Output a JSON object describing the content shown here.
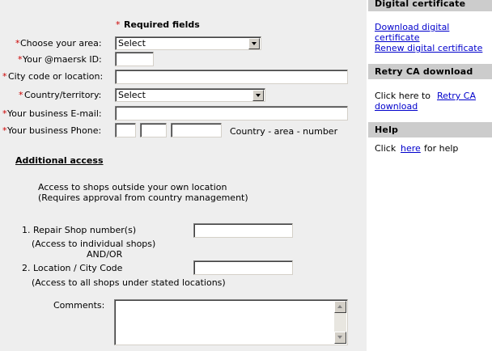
{
  "colors": {
    "required_marker": "#cc0000",
    "link": "#0000cc",
    "form_background": "#eeeeee",
    "sidebar_header_background": "#cccccc"
  },
  "form": {
    "required_marker": "*",
    "required_note": "Required fields",
    "fields": {
      "area": {
        "label": "Choose your area:",
        "value": "Select"
      },
      "maersk_id": {
        "label": "Your @maersk ID:",
        "value": ""
      },
      "city": {
        "label": "City code or location:",
        "value": ""
      },
      "country": {
        "label": "Country/territory:",
        "value": "Select"
      },
      "email": {
        "label": "Your business E-mail:",
        "value": ""
      },
      "phone": {
        "label": "Your business Phone:",
        "hint": "Country - area - number"
      }
    },
    "additional": {
      "heading": "Additional access",
      "intro_line1": "Access to shops outside your own location",
      "intro_line2": "(Requires approval from country management)",
      "repair_label": "1. Repair Shop number(s)",
      "repair_note": "(Access to individual shops)",
      "andor": "AND/OR",
      "location_label": "2. Location / City Code",
      "location_note": "(Access to all shops under stated locations)",
      "comments_label": "Comments:"
    }
  },
  "sidebar": {
    "digital_certificate": {
      "title": "Digital certificate",
      "download_line1": "Download digital",
      "download_line2": "certificate",
      "renew": "Renew digital certificate"
    },
    "retry": {
      "title": "Retry CA download",
      "text_prefix": "Click here to",
      "link_line1": "Retry CA",
      "link_line2": "download"
    },
    "help": {
      "title": "Help",
      "prefix": "Click",
      "link": "here",
      "suffix": "for help"
    }
  }
}
